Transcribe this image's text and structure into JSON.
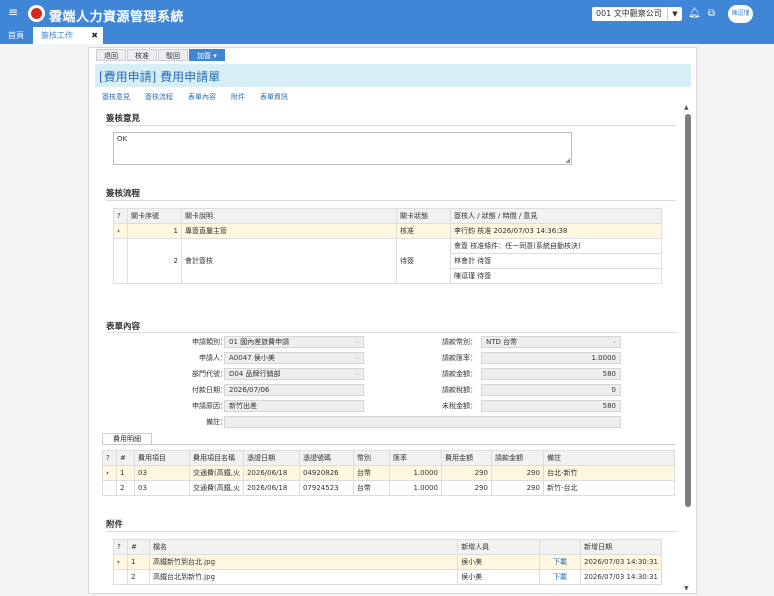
{
  "app": {
    "title": "雲端人力資源管理系統",
    "company": "001 文中觀察公司",
    "user": "陳逗瑾"
  },
  "tabs": [
    {
      "label": "首頁"
    },
    {
      "label": "簽核工作"
    }
  ],
  "toolbar": {
    "buttons": [
      "退回",
      "核准",
      "駁回",
      "加簽 ▾"
    ]
  },
  "form_title": "[費用申請] 費用申請單",
  "anchors": [
    "簽核意見",
    "簽核流程",
    "表單內容",
    "附件",
    "表單資訊"
  ],
  "comment": {
    "title": "簽核意見",
    "value": "OK"
  },
  "flow": {
    "title": "簽核流程",
    "headers": [
      "?",
      "關卡序號",
      "關卡說明",
      "關卡狀態",
      "簽核人 / 狀態 / 時間 / 意見"
    ],
    "rows": [
      {
        "marker": "›",
        "seq": "1",
        "desc": "專簽直屬主管",
        "status": "核准",
        "details": [
          "李行鈞 核准 2026/07/03 14:36:38"
        ]
      },
      {
        "marker": "",
        "seq": "2",
        "desc": "會計簽核",
        "status": "待簽",
        "details": [
          "會簽 核准條件：任一同意(系統自動核決)",
          "林會計 待簽",
          "陳逗瑾 待簽"
        ]
      }
    ]
  },
  "form": {
    "title": "表單內容",
    "left": [
      {
        "label": "申請類別：",
        "value": "01 國內差旅費申請",
        "dropdown": true
      },
      {
        "label": "申請人：",
        "value": "A0047 侯小美",
        "dropdown": true
      },
      {
        "label": "部門代號：",
        "value": "D04 品牌行銷部",
        "dropdown": true
      },
      {
        "label": "付款日期：",
        "value": "2026/07/06",
        "dropdown": false
      },
      {
        "label": "申請原因：",
        "value": "新竹出差",
        "dropdown": false
      }
    ],
    "right": [
      {
        "label": "請款幣別：",
        "value": "NTD 台幣",
        "dropdown": true,
        "num": false
      },
      {
        "label": "請款匯率：",
        "value": "1.0000",
        "dropdown": false,
        "num": true
      },
      {
        "label": "請款金額：",
        "value": "580",
        "dropdown": false,
        "num": true
      },
      {
        "label": "請款稅額：",
        "value": "0",
        "dropdown": false,
        "num": true
      },
      {
        "label": "未稅金額：",
        "value": "580",
        "dropdown": false,
        "num": true
      }
    ],
    "note_label": "備註：",
    "note_value": ""
  },
  "detail": {
    "tab": "費用明細",
    "headers": [
      "?",
      "#",
      "費用項目",
      "費用項目名稱",
      "憑證日期",
      "憑證號碼",
      "幣別",
      "匯率",
      "費用金額",
      "請款金額",
      "備註"
    ],
    "rows": [
      {
        "marker": "›",
        "no": "1",
        "item": "03",
        "name": "交通費(高鐵,火",
        "date": "2026/06/18",
        "voucher": "04920826",
        "cur": "台幣",
        "rate": "1.0000",
        "amt": "290",
        "claim": "290",
        "note": "台北-新竹"
      },
      {
        "marker": "",
        "no": "2",
        "item": "03",
        "name": "交通費(高鐵,火",
        "date": "2026/06/18",
        "voucher": "07924523",
        "cur": "台幣",
        "rate": "1.0000",
        "amt": "290",
        "claim": "290",
        "note": "新竹-台北"
      }
    ]
  },
  "attach": {
    "title": "附件",
    "headers": [
      "?",
      "#",
      "檔名",
      "新增人員",
      "",
      "新增日期"
    ],
    "rows": [
      {
        "marker": "›",
        "no": "1",
        "file": "高鐵新竹到台北.jpg",
        "user": "侯小美",
        "action": "下載",
        "date": "2026/07/03 14:30:31"
      },
      {
        "marker": "",
        "no": "2",
        "file": "高鐵台北到新竹.jpg",
        "user": "侯小美",
        "action": "下載",
        "date": "2026/07/03 14:30:31"
      }
    ]
  }
}
